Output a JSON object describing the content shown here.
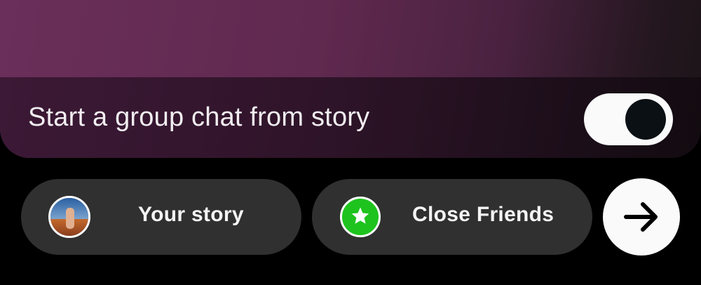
{
  "group_chat": {
    "label": "Start a group chat from story",
    "toggle_state": "on"
  },
  "share_options": {
    "your_story_label": "Your story",
    "close_friends_label": "Close Friends"
  },
  "icons": {
    "close_friends": "star-icon",
    "send": "arrow-right-icon"
  },
  "colors": {
    "close_friends_green": "#1ec31e",
    "pill_background": "#2f302f",
    "toggle_track": "#fafafa",
    "toggle_knob": "#0b1014"
  }
}
